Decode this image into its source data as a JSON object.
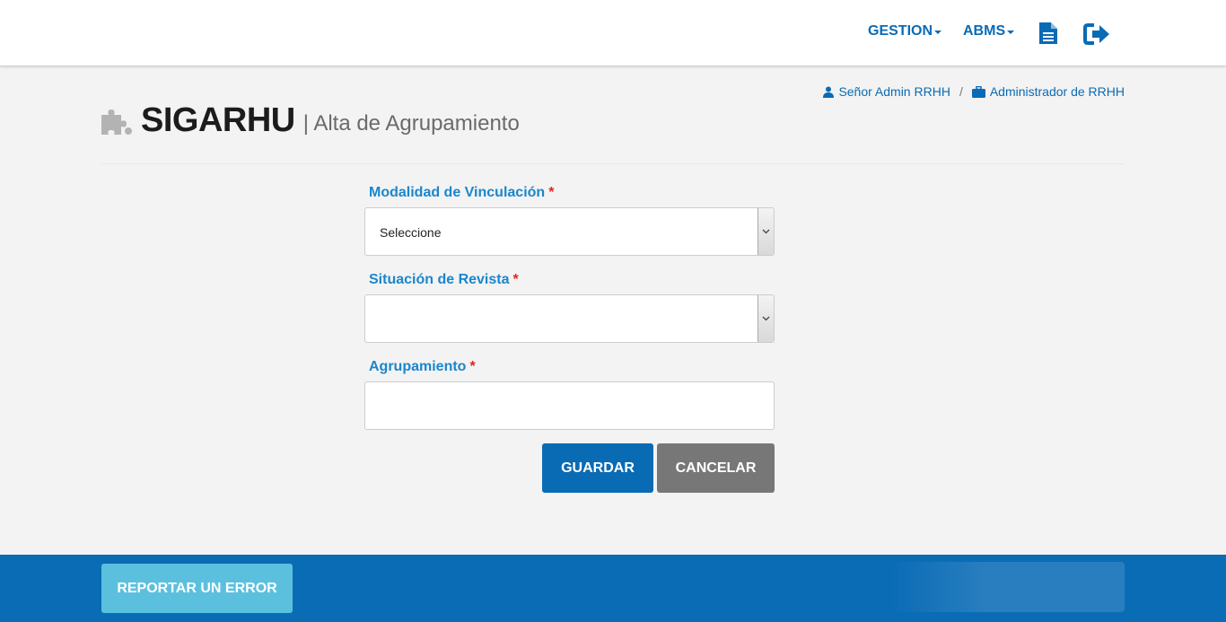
{
  "nav": {
    "gestion_label": "GESTION",
    "abms_label": "ABMS",
    "document_icon": "document-icon",
    "logout_icon": "sign-out-icon"
  },
  "breadcrumb": {
    "user": "Señor Admin RRHH",
    "separator": "/",
    "role": "Administrador de RRHH"
  },
  "header": {
    "title": "SIGARHU",
    "subtitle": "| Alta de Agrupamiento",
    "icon": "puzzle-icon"
  },
  "form": {
    "modalidad": {
      "label": "Modalidad de Vinculación",
      "required_mark": "*",
      "value": "Seleccione"
    },
    "situacion": {
      "label": "Situación de Revista",
      "required_mark": "*",
      "value": ""
    },
    "agrupamiento": {
      "label": "Agrupamiento",
      "required_mark": "*",
      "value": ""
    }
  },
  "buttons": {
    "save_label": "GUARDAR",
    "cancel_label": "CANCELAR"
  },
  "footer": {
    "report_label": "REPORTAR UN ERROR"
  },
  "colors": {
    "primary": "#0a6bb5",
    "label": "#1a86cc",
    "required": "#e02222",
    "cancel": "#777777",
    "report": "#5bc0de"
  }
}
